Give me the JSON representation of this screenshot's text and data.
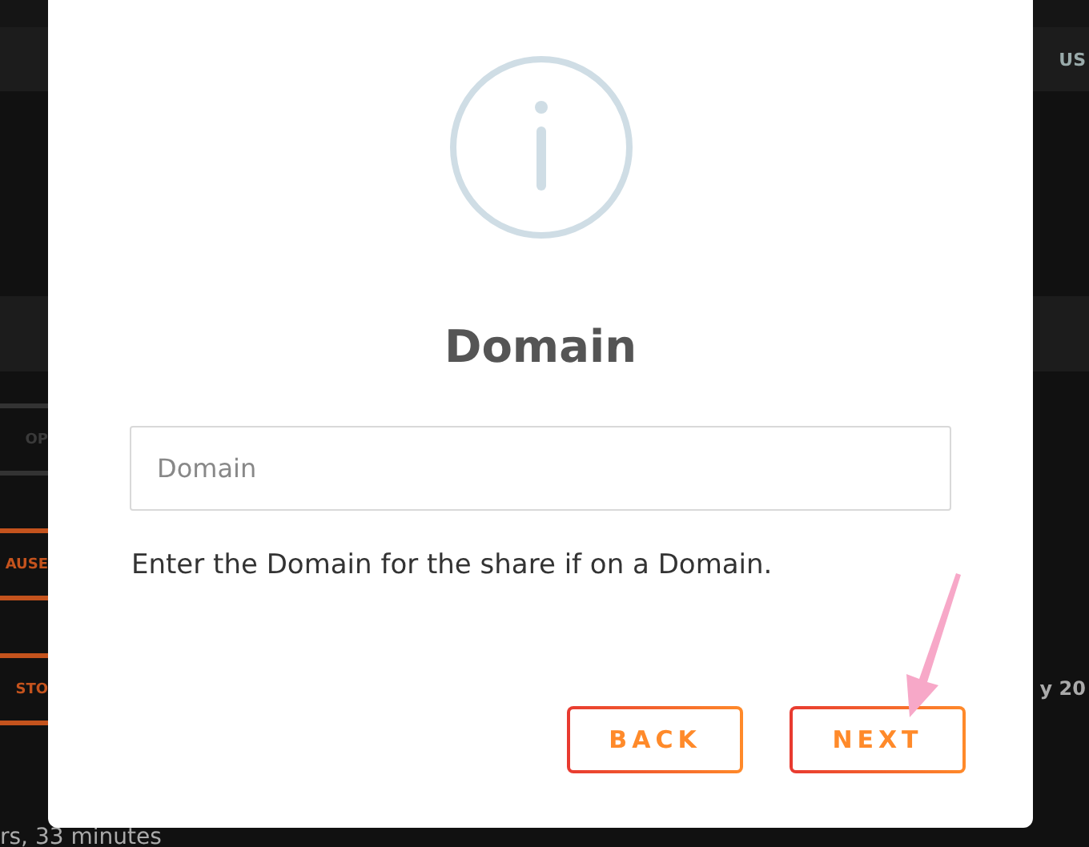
{
  "background": {
    "header_text": "US",
    "buttons": [
      {
        "label": "OP",
        "disabled": true
      },
      {
        "label": "AUSE",
        "disabled": false
      },
      {
        "label": "STO",
        "disabled": false
      }
    ],
    "date_text": "y 20",
    "duration_text": "rs, 33 minutes"
  },
  "dialog": {
    "title": "Domain",
    "field": {
      "placeholder": "Domain"
    },
    "help": "Enter the Domain for the share if on a Domain.",
    "buttons": [
      "BACK",
      "NEXT"
    ]
  }
}
